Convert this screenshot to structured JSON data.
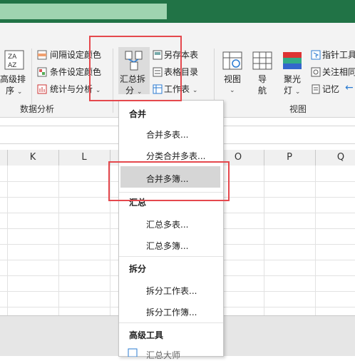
{
  "ribbon": {
    "sort_label_line1": "高级排",
    "sort_label_line2": "序",
    "interval_color": "间隔设定颜色",
    "cond_color": "条件设定颜色",
    "stats_analysis": "统计与分析",
    "group_data_analysis": "数据分析",
    "summary_split_line1": "汇总拆",
    "summary_split_line2": "分",
    "save_as_table": "另存本表",
    "table_directory": "表格目录",
    "worksheet": "工作表",
    "view_label": "视图",
    "nav_line1": "导",
    "nav_line2": "航",
    "spotlight_line1": "聚光",
    "spotlight_line2": "灯",
    "pointer_tool": "指针工具",
    "focus_related": "关注相同",
    "memo": "记忆",
    "group_view": "视图"
  },
  "columns": [
    "K",
    "L",
    "O",
    "P",
    "Q"
  ],
  "menu": {
    "section_merge": "合并",
    "merge_sheets": "合并多表...",
    "category_merge": "分类合并多表...",
    "merge_workbooks": "合并多簿...",
    "section_summary": "汇总",
    "summarize_sheets": "汇总多表...",
    "summarize_workbooks": "汇总多簿...",
    "section_split": "拆分",
    "split_sheet": "拆分工作表...",
    "split_workbook": "拆分工作簿...",
    "section_advanced": "高级工具",
    "summary_outline": "汇总大师"
  },
  "colors": {
    "title_bar": "#217346",
    "highlight_box": "#e5484d"
  }
}
